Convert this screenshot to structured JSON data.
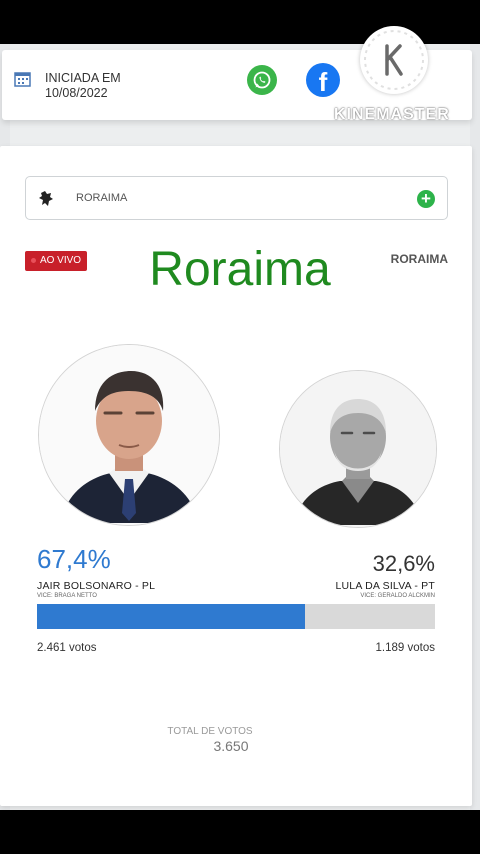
{
  "header": {
    "started_label": "INICIADA EM",
    "started_date": "10/08/2022",
    "watermark": "KINEMASTER"
  },
  "search": {
    "state": "RORAIMA"
  },
  "live": {
    "badge": "AO VIVO",
    "title": "Roraima",
    "state_label": "RORAIMA"
  },
  "candidates": [
    {
      "name": "JAIR BOLSONARO - PL",
      "vice": "VICE: BRAGA NETTO",
      "percent": "67,4%",
      "votes": "2.461 votos",
      "share": 0.674,
      "color": "#2f7ad0"
    },
    {
      "name": "LULA DA SILVA - PT",
      "vice": "VICE: GERALDO ALCKMIN",
      "percent": "32,6%",
      "votes": "1.189 votos",
      "share": 0.326,
      "color": "#d9d9d9"
    }
  ],
  "total": {
    "label": "TOTAL DE VOTOS",
    "value": "3.650"
  },
  "colors": {
    "accent_blue": "#2f7ad0",
    "live_red": "#c8202a",
    "title_green": "#1f8a1f",
    "whatsapp": "#3bb54a",
    "facebook": "#1877f2"
  },
  "icons": [
    "calendar-icon",
    "whatsapp-icon",
    "facebook-icon",
    "state-map-icon",
    "add-icon",
    "kinemaster-logo-icon"
  ]
}
